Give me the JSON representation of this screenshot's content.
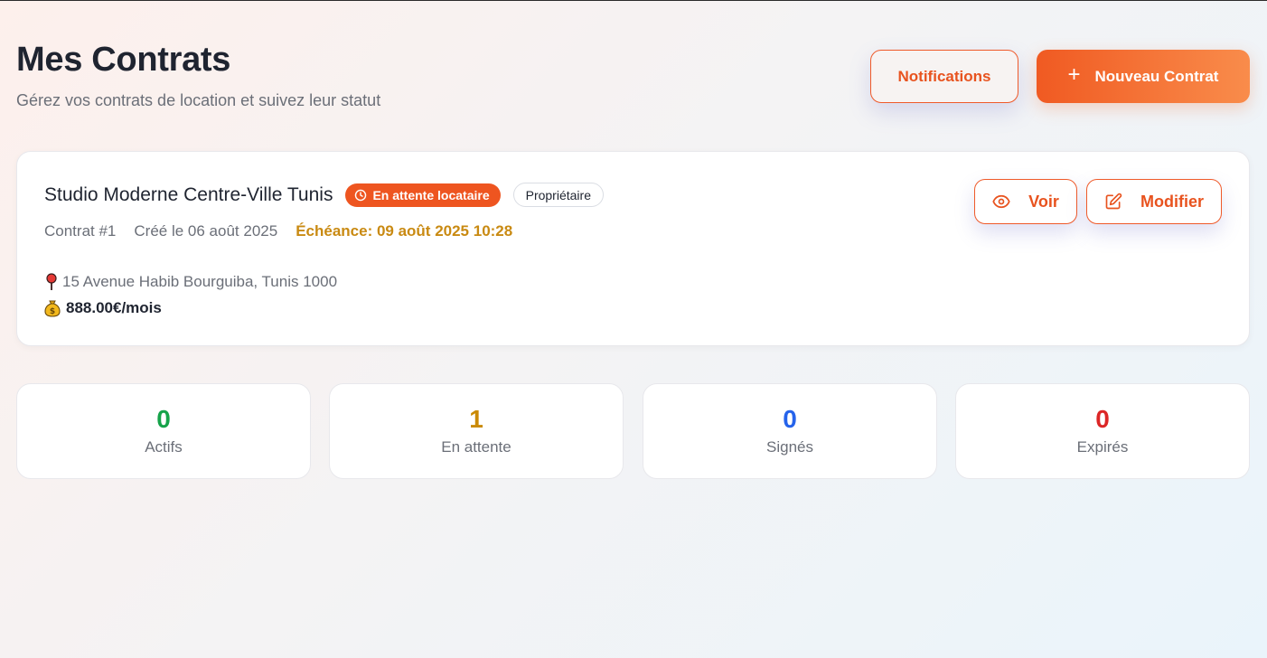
{
  "header": {
    "title": "Mes Contrats",
    "subtitle": "Gérez vos contrats de location et suivez leur statut",
    "notifications_label": "Notifications",
    "new_contract_label": "Nouveau Contrat",
    "new_contract_icon": "plus-icon"
  },
  "contract": {
    "title": "Studio Moderne Centre-Ville Tunis",
    "status_badge": "En attente locataire",
    "status_icon": "clock-icon",
    "role_badge": "Propriétaire",
    "number": "Contrat #1",
    "created": "Créé le 06 août 2025",
    "deadline": "Échéance: 09 août 2025 10:28",
    "address_icon": "pin-icon",
    "address": "15 Avenue Habib Bourguiba, Tunis 1000",
    "price_icon": "money-bag-icon",
    "price": "888.00€/mois",
    "view_label": "Voir",
    "view_icon": "eye-icon",
    "edit_label": "Modifier",
    "edit_icon": "edit-icon"
  },
  "stats": [
    {
      "value": "0",
      "label": "Actifs",
      "color": "#16a34a"
    },
    {
      "value": "1",
      "label": "En attente",
      "color": "#ca8a04"
    },
    {
      "value": "0",
      "label": "Signés",
      "color": "#2563eb"
    },
    {
      "value": "0",
      "label": "Expirés",
      "color": "#dc2626"
    }
  ],
  "colors": {
    "accent": "#ef5a2a",
    "deadline": "#c98a12"
  }
}
